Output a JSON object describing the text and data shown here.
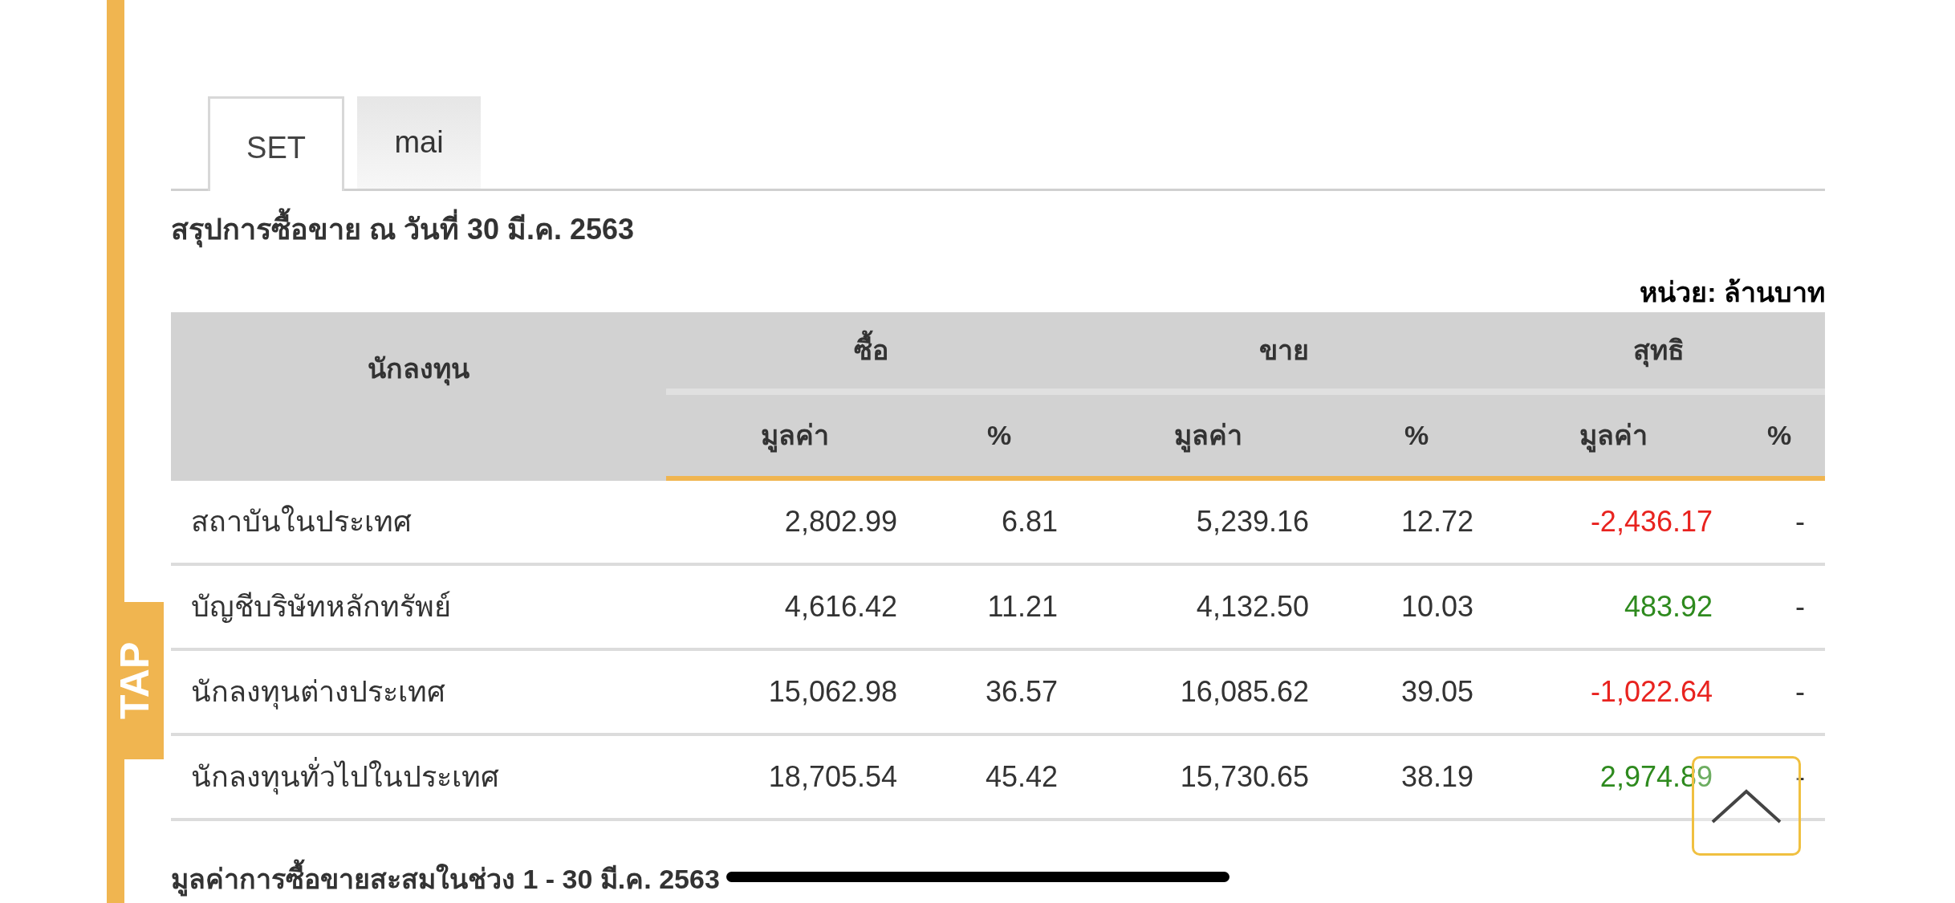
{
  "side_tab": {
    "label": "TAP"
  },
  "tabs": [
    {
      "label": "SET",
      "selected": true
    },
    {
      "label": "mai",
      "selected": false
    }
  ],
  "title": "สรุปการซื้อขาย ณ วันที่ 30 มี.ค. 2563",
  "unit": "หน่วย: ล้านบาท",
  "table": {
    "investor_header": "นักลงทุน",
    "groups": [
      {
        "label": "ซื้อ",
        "columns": [
          "มูลค่า",
          "%"
        ]
      },
      {
        "label": "ขาย",
        "columns": [
          "มูลค่า",
          "%"
        ]
      },
      {
        "label": "สุทธิ",
        "columns": [
          "มูลค่า",
          "%"
        ]
      }
    ],
    "rows": [
      {
        "investor": "สถาบันในประเทศ",
        "buy_value": "2,802.99",
        "buy_pct": "6.81",
        "sell_value": "5,239.16",
        "sell_pct": "12.72",
        "net": {
          "value": "-2,436.17",
          "color": "#e8231f"
        },
        "net_pct": "-"
      },
      {
        "investor": "บัญชีบริษัทหลักทรัพย์",
        "buy_value": "4,616.42",
        "buy_pct": "11.21",
        "sell_value": "4,132.50",
        "sell_pct": "10.03",
        "net": {
          "value": "483.92",
          "color": "#2e8a1e"
        },
        "net_pct": "-"
      },
      {
        "investor": "นักลงทุนต่างประเทศ",
        "buy_value": "15,062.98",
        "buy_pct": "36.57",
        "sell_value": "16,085.62",
        "sell_pct": "39.05",
        "net": {
          "value": "-1,022.64",
          "color": "#e8231f"
        },
        "net_pct": "-"
      },
      {
        "investor": "นักลงทุนทั่วไปในประเทศ",
        "buy_value": "18,705.54",
        "buy_pct": "45.42",
        "sell_value": "15,730.65",
        "sell_pct": "38.19",
        "net": {
          "value": "2,974.89",
          "color": "#2e8a1e"
        },
        "net_pct": "-"
      }
    ]
  },
  "next_heading": "มูลค่าการซื้อขายสะสมในช่วง 1 - 30 มี.ค. 2563"
}
